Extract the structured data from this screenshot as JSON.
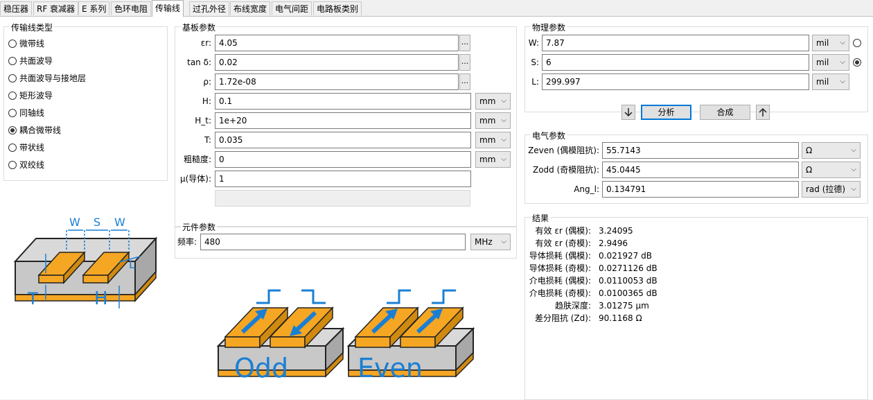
{
  "tabs": [
    "稳压器",
    "RF 衰减器",
    "E 系列",
    "色环电阻",
    "传输线",
    "过孔外径",
    "布线宽度",
    "电气间距",
    "电路板类别"
  ],
  "line_type": {
    "title": "传输线类型",
    "options": [
      "微带线",
      "共面波导",
      "共面波导与接地层",
      "矩形波导",
      "同轴线",
      "耦合微带线",
      "带状线",
      "双绞线"
    ],
    "selected_index": 5
  },
  "substrate": {
    "title": "基板参数",
    "rows": [
      {
        "label": "εr:",
        "value": "4.05",
        "dots": "..."
      },
      {
        "label": "tan δ:",
        "value": "0.02",
        "dots": "..."
      },
      {
        "label": "ρ:",
        "value": "1.72e-08",
        "dots": "..."
      },
      {
        "label": "H:",
        "value": "0.1",
        "unit": "mm"
      },
      {
        "label": "H_t:",
        "value": "1e+20",
        "unit": "mm"
      },
      {
        "label": "T:",
        "value": "0.035",
        "unit": "mm"
      },
      {
        "label": "粗糙度:",
        "value": "0",
        "unit": "mm"
      },
      {
        "label": "μ(导体):",
        "value": "1"
      }
    ]
  },
  "component": {
    "title": "元件参数",
    "freq_label": "频率:",
    "freq_value": "480",
    "freq_unit": "MHz"
  },
  "physical": {
    "title": "物理参数",
    "rows": [
      {
        "label": "W:",
        "value": "7.87",
        "unit": "mil",
        "radio_selected": false
      },
      {
        "label": "S:",
        "value": "6",
        "unit": "mil",
        "radio_selected": true
      },
      {
        "label": "L:",
        "value": "299.997",
        "unit": "mil"
      }
    ]
  },
  "actions": {
    "analyze": "分析",
    "synthesize": "合成",
    "down_icon": "arrow-down-icon",
    "up_icon": "arrow-up-icon"
  },
  "electrical": {
    "title": "电气参数",
    "rows": [
      {
        "label": "Zeven (偶模阻抗):",
        "value": "55.7143",
        "unit": "Ω"
      },
      {
        "label": "Zodd (奇模阻抗):",
        "value": "45.0445",
        "unit": "Ω"
      },
      {
        "label": "Ang_l:",
        "value": "0.134791",
        "unit": "rad (拉德)"
      }
    ]
  },
  "results": {
    "title": "结果",
    "rows": [
      {
        "label": "有效 εr (偶模):",
        "value": "3.24095"
      },
      {
        "label": "有效 εr (奇模):",
        "value": "2.9496"
      },
      {
        "label": "导体损耗 (偶模):",
        "value": "0.021927 dB"
      },
      {
        "label": "导体损耗 (奇模):",
        "value": "0.0271126 dB"
      },
      {
        "label": "介电损耗 (偶模):",
        "value": "0.0110053 dB"
      },
      {
        "label": "介电损耗 (奇模):",
        "value": "0.0100365 dB"
      },
      {
        "label": "趋肤深度:",
        "value": "3.01275 μm"
      },
      {
        "label": "差分阻抗 (Zd):",
        "value": "90.1168 Ω"
      }
    ]
  },
  "diagram": {
    "w1": "W",
    "s": "S",
    "w2": "W",
    "l": "L",
    "t": "T",
    "h": "H",
    "odd": "Odd",
    "even": "Even"
  },
  "colors": {
    "copper": "#f5a623",
    "substrate": "#c8c8c8",
    "accent": "#1a7fd4"
  }
}
